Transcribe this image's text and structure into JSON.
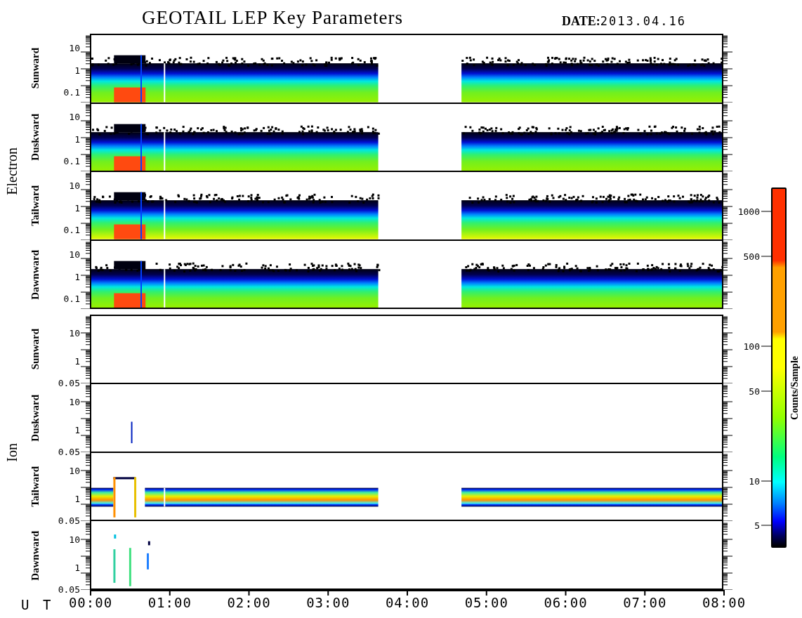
{
  "title": "GEOTAIL LEP Key Parameters",
  "date": {
    "label": "DATE:",
    "value": "2013.04.16"
  },
  "groups": [
    {
      "label": "Electron",
      "kind": "electron",
      "panels": [
        {
          "label": "Sunward",
          "kind": "dense",
          "ticks": [
            "10",
            "1",
            "0.1"
          ]
        },
        {
          "label": "Duskward",
          "kind": "dense",
          "ticks": [
            "10",
            "1",
            "0.1"
          ]
        },
        {
          "label": "Tailward",
          "kind": "dense",
          "ticks": [
            "10",
            "1",
            "0.1"
          ]
        },
        {
          "label": "Dawnward",
          "kind": "dense",
          "ticks": [
            "10",
            "1",
            "0.1"
          ]
        }
      ]
    },
    {
      "label": "Ion",
      "kind": "ion",
      "panels": [
        {
          "label": "Sunward",
          "kind": "empty",
          "ticks": [
            "10",
            "1",
            "0.05"
          ]
        },
        {
          "label": "Duskward",
          "kind": "spike",
          "ticks": [
            "10",
            "1",
            "0.05"
          ]
        },
        {
          "label": "Tailward",
          "kind": "band",
          "ticks": [
            "10",
            "1",
            "0.05"
          ]
        },
        {
          "label": "Dawnward",
          "kind": "bursts",
          "ticks": [
            "10",
            "1",
            "0.05"
          ]
        }
      ]
    }
  ],
  "x_axis": {
    "label": "U T",
    "ticks": [
      "00:00",
      "01:00",
      "02:00",
      "03:00",
      "04:00",
      "05:00",
      "06:00",
      "07:00",
      "08:00"
    ]
  },
  "colorbar": {
    "label": "Counts/Sample",
    "ticks": [
      "1000",
      "500",
      "100",
      "50",
      "10",
      "5"
    ]
  }
}
